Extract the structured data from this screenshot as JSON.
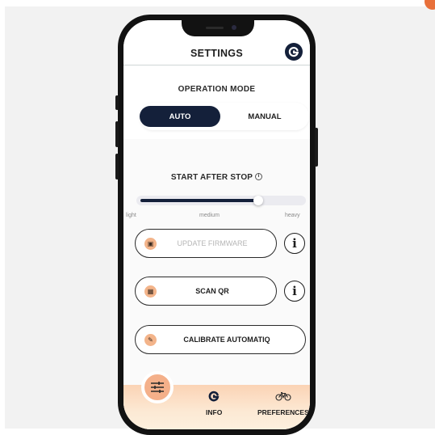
{
  "header": {
    "title": "SETTINGS",
    "logo_icon": "brand-g-icon"
  },
  "operation_mode": {
    "label": "OPERATION MODE",
    "options": [
      "AUTO",
      "MANUAL"
    ],
    "selected": "AUTO"
  },
  "start_after_stop": {
    "label": "START AFTER STOP",
    "info_icon": "info-icon",
    "slider": {
      "value": 0.73,
      "ticks": [
        "light",
        "medium",
        "heavy"
      ]
    }
  },
  "actions": {
    "update_firmware": {
      "label": "UPDATE FIRMWARE",
      "icon": "firmware-chip-icon",
      "enabled": false
    },
    "scan_qr": {
      "label": "SCAN QR",
      "icon": "qr-code-icon"
    },
    "calibrate": {
      "label": "CALIBRATE AUTOMATIQ",
      "icon": "wrench-icon"
    }
  },
  "bottom_nav": {
    "settings_icon": "sliders-icon",
    "items": [
      {
        "label": "INFO",
        "icon": "brand-g-icon"
      },
      {
        "label": "PREFERENCES",
        "icon": "bicycle-icon"
      }
    ]
  },
  "colors": {
    "primary": "#14203a",
    "accent": "#f4b08a",
    "nav_gradient_start": "#fbd3b5",
    "nav_gradient_end": "#fdf0de"
  }
}
